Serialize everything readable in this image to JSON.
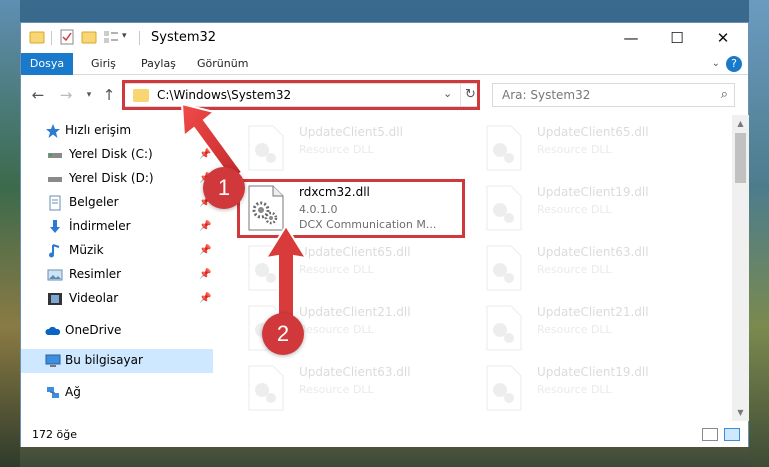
{
  "window": {
    "title": "System32"
  },
  "ribbon": {
    "tabs": [
      "Dosya",
      "Giriş",
      "Paylaş",
      "Görünüm"
    ]
  },
  "address": {
    "path": "C:\\Windows\\System32",
    "search_placeholder": "Ara: System32"
  },
  "nav": {
    "quick_access": "Hızlı erişim",
    "items": [
      {
        "label": "Yerel Disk (C:)",
        "icon": "drive-icon",
        "pinned": true
      },
      {
        "label": "Yerel Disk (D:)",
        "icon": "drive-icon",
        "pinned": true
      },
      {
        "label": "Belgeler",
        "icon": "documents-icon",
        "pinned": true
      },
      {
        "label": "İndirmeler",
        "icon": "downloads-icon",
        "pinned": true
      },
      {
        "label": "Müzik",
        "icon": "music-icon",
        "pinned": true
      },
      {
        "label": "Resimler",
        "icon": "pictures-icon",
        "pinned": true
      },
      {
        "label": "Videolar",
        "icon": "videos-icon",
        "pinned": true
      }
    ],
    "onedrive": "OneDrive",
    "this_pc": "Bu bilgisayar",
    "network": "Ağ"
  },
  "files": [
    {
      "name": "UpdateClient5.dll",
      "line2": "Resource DLL",
      "line3": "",
      "faded": true
    },
    {
      "name": "UpdateClient65.dll",
      "line2": "Resource DLL",
      "line3": "",
      "faded": true
    },
    {
      "name": "rdxcm32.dll",
      "line2": "4.0.1.0",
      "line3": "DCX Communication M...",
      "faded": false
    },
    {
      "name": "UpdateClient19.dll",
      "line2": "Resource DLL",
      "line3": "",
      "faded": true
    },
    {
      "name": "UpdateClient65.dll",
      "line2": "Resource DLL",
      "line3": "",
      "faded": true
    },
    {
      "name": "UpdateClient63.dll",
      "line2": "Resource DLL",
      "line3": "",
      "faded": true
    },
    {
      "name": "UpdateClient21.dll",
      "line2": "Resource DLL",
      "line3": "",
      "faded": true
    },
    {
      "name": "UpdateClient21.dll",
      "line2": "Resource DLL",
      "line3": "",
      "faded": true
    },
    {
      "name": "UpdateClient63.dll",
      "line2": "Resource DLL",
      "line3": "",
      "faded": true
    },
    {
      "name": "UpdateClient19.dll",
      "line2": "Resource DLL",
      "line3": "",
      "faded": true
    }
  ],
  "status": {
    "item_count": "172 öğe"
  },
  "annotations": {
    "step1": "1",
    "step2": "2",
    "highlight_color": "#d0383b"
  },
  "colors": {
    "accent": "#1979ca",
    "selected_nav": "#cde8ff"
  }
}
